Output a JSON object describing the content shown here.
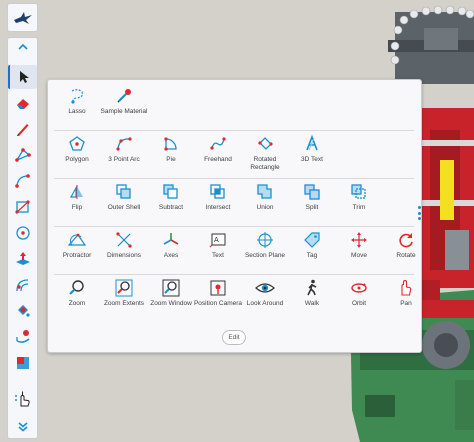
{
  "app": {
    "logo_icon": "onshape-pilot-icon"
  },
  "toolbar": {
    "collapse_icon": "chevron-up-icon",
    "items": [
      {
        "name": "select-tool-button",
        "icon": "cursor-icon",
        "active": true
      },
      {
        "name": "eraser-tool-button",
        "icon": "eraser-icon"
      },
      {
        "name": "pencil-tool-button",
        "icon": "pencil-icon"
      },
      {
        "name": "polygon-tool-button",
        "icon": "polygon-icon"
      },
      {
        "name": "curve-tool-button",
        "icon": "curve-icon"
      },
      {
        "name": "rectangle-tool-button",
        "icon": "rectangle-icon"
      },
      {
        "name": "circle-tool-button",
        "icon": "circle-icon"
      },
      {
        "name": "push-pull-tool-button",
        "icon": "push-pull-icon"
      },
      {
        "name": "offset-tool-button",
        "icon": "offset-icon"
      },
      {
        "name": "paint-tool-button",
        "icon": "paint-bucket-icon"
      },
      {
        "name": "sweep-tool-button",
        "icon": "sweep-icon"
      },
      {
        "name": "section-tool-button",
        "icon": "section-box-icon"
      },
      {
        "name": "more-tools-button",
        "icon": "more-hand-icon"
      }
    ],
    "expand_icon": "double-chevron-down-icon"
  },
  "tools_panel": {
    "rows": [
      [
        {
          "label": "Lasso",
          "icon": "lasso-icon"
        },
        {
          "label": "Sample Material",
          "icon": "eyedropper-icon"
        }
      ],
      [
        {
          "label": "Polygon",
          "icon": "polygon-icon"
        },
        {
          "label": "3 Point Arc",
          "icon": "three-point-arc-icon"
        },
        {
          "label": "Pie",
          "icon": "pie-icon"
        },
        {
          "label": "Freehand",
          "icon": "freehand-icon"
        },
        {
          "label": "Rotated Rectangle",
          "icon": "rotated-rectangle-icon"
        },
        {
          "label": "3D Text",
          "icon": "3d-text-icon"
        }
      ],
      [
        {
          "label": "Flip",
          "icon": "flip-icon"
        },
        {
          "label": "Outer Shell",
          "icon": "outer-shell-icon"
        },
        {
          "label": "Subtract",
          "icon": "subtract-icon"
        },
        {
          "label": "Intersect",
          "icon": "intersect-icon"
        },
        {
          "label": "Union",
          "icon": "union-icon"
        },
        {
          "label": "Split",
          "icon": "split-icon"
        },
        {
          "label": "Trim",
          "icon": "trim-icon"
        }
      ],
      [
        {
          "label": "Protractor",
          "icon": "protractor-icon"
        },
        {
          "label": "Dimensions",
          "icon": "dimensions-icon"
        },
        {
          "label": "Axes",
          "icon": "axes-icon"
        },
        {
          "label": "Text",
          "icon": "text-icon"
        },
        {
          "label": "Section Plane",
          "icon": "section-plane-icon"
        },
        {
          "label": "Tag",
          "icon": "tag-icon"
        },
        {
          "label": "Move",
          "icon": "move-icon"
        },
        {
          "label": "Rotate",
          "icon": "rotate-icon"
        }
      ],
      [
        {
          "label": "Zoom",
          "icon": "zoom-icon"
        },
        {
          "label": "Zoom Extents",
          "icon": "zoom-extents-icon"
        },
        {
          "label": "Zoom Window",
          "icon": "zoom-window-icon"
        },
        {
          "label": "Position Camera",
          "icon": "position-camera-icon"
        },
        {
          "label": "Look Around",
          "icon": "look-around-eye-icon"
        },
        {
          "label": "Walk",
          "icon": "walk-icon"
        },
        {
          "label": "Orbit",
          "icon": "orbit-icon"
        },
        {
          "label": "Pan",
          "icon": "pan-hand-icon"
        }
      ]
    ],
    "edit_label": "Edit"
  },
  "colors": {
    "accent_blue": "#1a8fd0",
    "accent_red": "#e0282e",
    "panel_bg": "#f8f8fa",
    "model_green": "#3e8a52",
    "model_red": "#c8232b",
    "model_grey": "#5a6066"
  }
}
